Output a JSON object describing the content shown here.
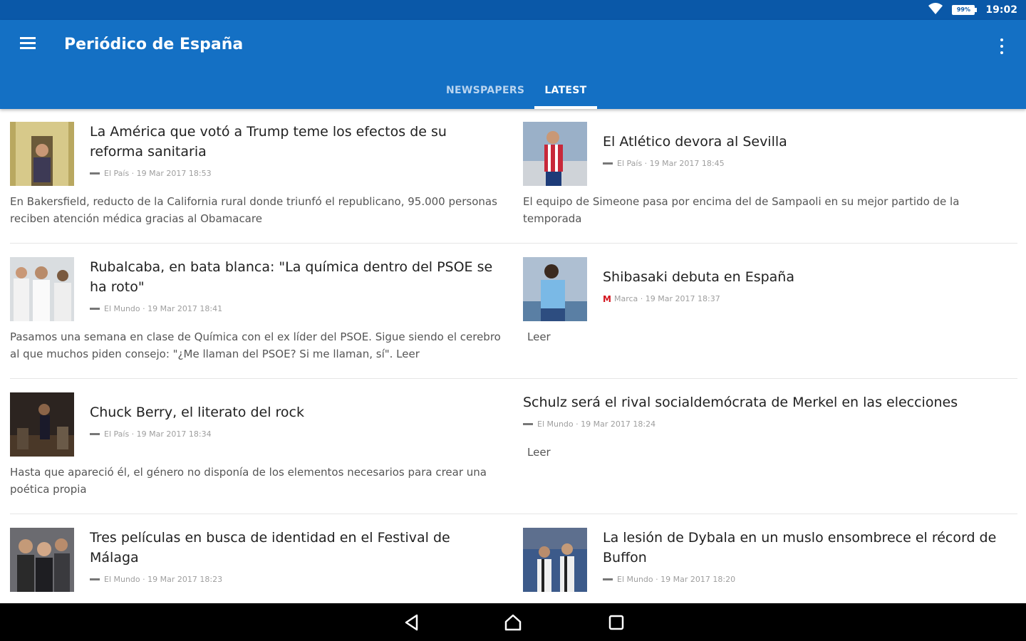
{
  "status": {
    "battery": "99%",
    "time": "19:02"
  },
  "app": {
    "title": "Periódico de España"
  },
  "tabs": [
    {
      "label": "NEWSPAPERS",
      "active": false
    },
    {
      "label": "LATEST",
      "active": true
    }
  ],
  "articles": [
    {
      "title": "La América que votó a Trump teme los efectos de su reforma sanitaria",
      "meta": "El País · 19 Mar 2017 18:53",
      "summary": "En Bakersfield, reducto de la California rural donde triunfó el republicano, 95.000 personas reciben atención médica gracias al Obamacare"
    },
    {
      "title": "El Atlético devora al Sevilla",
      "meta": "El País · 19 Mar 2017 18:45",
      "summary": "El equipo de Simeone pasa por encima del de Sampaoli en su mejor partido de la temporada"
    },
    {
      "title": "Rubalcaba, en bata blanca: \"La química dentro del PSOE se ha roto\"",
      "meta": "El Mundo · 19 Mar 2017 18:41",
      "summary": "Pasamos una semana en clase de Química con el ex líder del PSOE. Sigue siendo el cerebro al que muchos piden consejo: \"¿Me llaman del PSOE? Si me llaman, sí\". Leer"
    },
    {
      "title": "Shibasaki debuta en España",
      "meta": "Marca · 19 Mar 2017 18:37",
      "summary": "Leer"
    },
    {
      "title": "Chuck Berry, el literato del rock",
      "meta": "El País · 19 Mar 2017 18:34",
      "summary": "Hasta que apareció él, el género no disponía de los elementos necesarios para crear una poética propia"
    },
    {
      "title": "Schulz será el rival socialdemócrata de Merkel en las elecciones",
      "meta": "El Mundo · 19 Mar 2017 18:24",
      "summary": "Leer"
    },
    {
      "title": "Tres películas en busca de identidad en el Festival de Málaga",
      "meta": "El Mundo · 19 Mar 2017 18:23",
      "summary": ""
    },
    {
      "title": "La lesión de Dybala en un muslo ensombrece el récord de Buffon",
      "meta": "El Mundo · 19 Mar 2017 18:20",
      "summary": ""
    }
  ]
}
